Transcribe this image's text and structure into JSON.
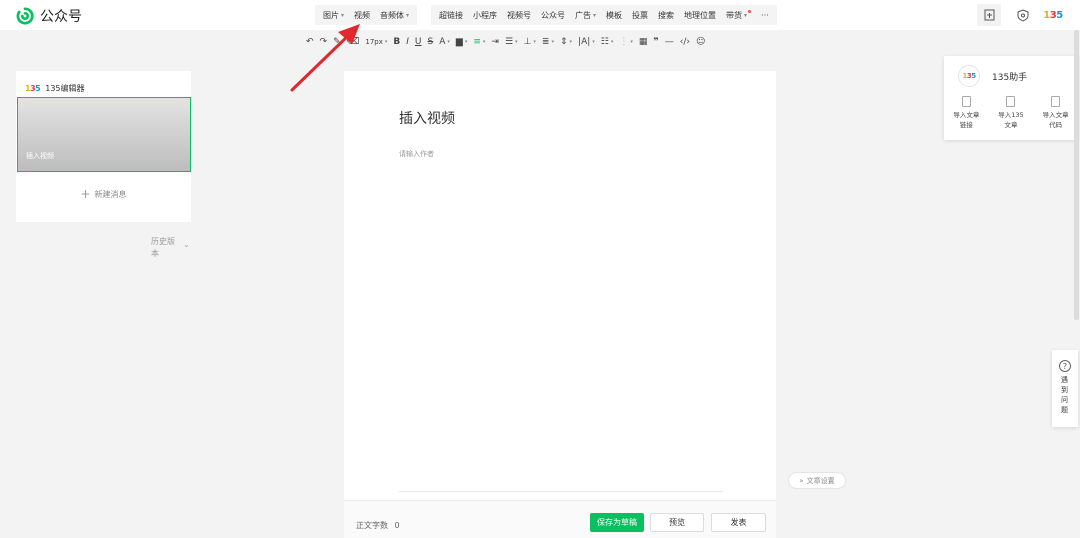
{
  "app": {
    "name": "公众号"
  },
  "menu": {
    "group1": [
      {
        "label": "图片",
        "has_dropdown": true
      },
      {
        "label": "视频",
        "has_dropdown": false
      },
      {
        "label": "音频体",
        "has_dropdown": true
      }
    ],
    "group2": [
      {
        "label": "超链接",
        "has_dropdown": false
      },
      {
        "label": "小程序",
        "has_dropdown": false
      },
      {
        "label": "视频号",
        "has_dropdown": false
      },
      {
        "label": "公众号",
        "has_dropdown": false
      },
      {
        "label": "广告",
        "has_dropdown": true
      },
      {
        "label": "模板",
        "has_dropdown": false
      },
      {
        "label": "投票",
        "has_dropdown": false
      },
      {
        "label": "搜索",
        "has_dropdown": false
      },
      {
        "label": "地理位置",
        "has_dropdown": false
      },
      {
        "label": "带货",
        "has_dropdown": true
      },
      {
        "label": "···",
        "has_dropdown": false
      }
    ]
  },
  "toolbar": {
    "font_size": "17px"
  },
  "left_panel": {
    "editor_name": "135编辑器",
    "article_title": "插入视频",
    "new_message": "新建消息",
    "history": "历史版本"
  },
  "editor": {
    "title": "插入视频",
    "author_placeholder": "请输入作者",
    "word_count_label": "正文字数",
    "word_count": "0",
    "save_draft": "保存为草稿",
    "preview": "预览",
    "publish": "发表",
    "article_settings": "文章设置"
  },
  "helper": {
    "title": "135助手",
    "actions": [
      "导入文章链接",
      "导入135文章",
      "导入文章代码"
    ]
  },
  "help": {
    "label": "遇到问题"
  },
  "colors": {
    "accent": "#07c160",
    "arrow": "#e0282e"
  },
  "icons": [
    "document-icon",
    "shield-icon",
    "logo-135-icon",
    "undo-icon",
    "redo-icon",
    "format-brush-icon",
    "clear-format-icon",
    "bold-icon",
    "italic-icon",
    "underline-icon",
    "strikethrough-icon",
    "font-color-icon",
    "bg-color-icon",
    "align-left-icon",
    "table-icon",
    "quote-icon",
    "divider-icon",
    "code-icon",
    "emoji-icon"
  ]
}
